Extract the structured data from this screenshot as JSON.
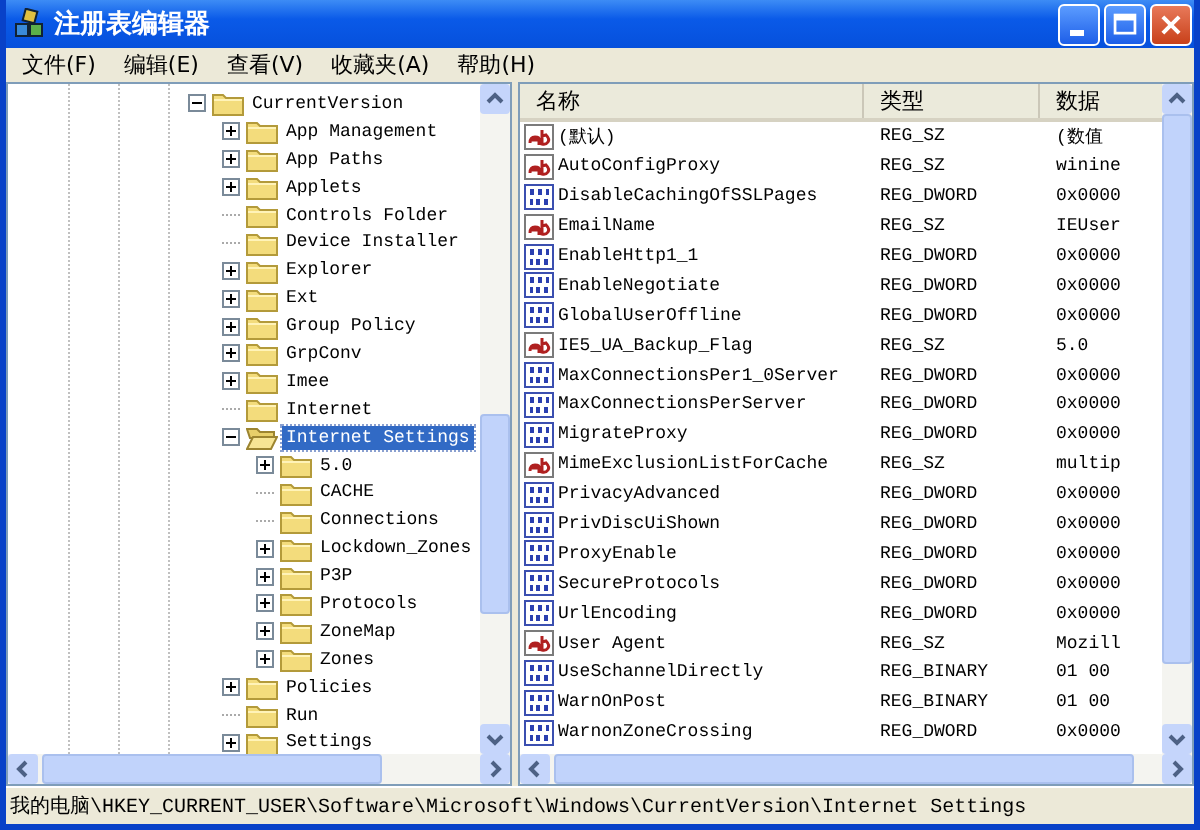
{
  "window": {
    "title": "注册表编辑器"
  },
  "menu": [
    {
      "label": "文件(F)"
    },
    {
      "label": "编辑(E)"
    },
    {
      "label": "查看(V)"
    },
    {
      "label": "收藏夹(A)"
    },
    {
      "label": "帮助(H)"
    }
  ],
  "tree": [
    {
      "label": "CurrentVersion",
      "kind": "branch",
      "expanded": true,
      "selected": false,
      "children": [
        {
          "label": "App Management",
          "kind": "branch",
          "expanded": false,
          "selected": false
        },
        {
          "label": "App Paths",
          "kind": "branch",
          "expanded": false,
          "selected": false
        },
        {
          "label": "Applets",
          "kind": "branch",
          "expanded": false,
          "selected": false
        },
        {
          "label": "Controls Folder",
          "kind": "leaf",
          "selected": false
        },
        {
          "label": "Device Installer",
          "kind": "leaf",
          "selected": false
        },
        {
          "label": "Explorer",
          "kind": "branch",
          "expanded": false,
          "selected": false
        },
        {
          "label": "Ext",
          "kind": "branch",
          "expanded": false,
          "selected": false
        },
        {
          "label": "Group Policy",
          "kind": "branch",
          "expanded": false,
          "selected": false
        },
        {
          "label": "GrpConv",
          "kind": "branch",
          "expanded": false,
          "selected": false
        },
        {
          "label": "Imee",
          "kind": "branch",
          "expanded": false,
          "selected": false
        },
        {
          "label": "Internet",
          "kind": "leaf",
          "selected": false
        },
        {
          "label": "Internet Settings",
          "kind": "branch",
          "expanded": true,
          "selected": true,
          "children": [
            {
              "label": "5.0",
              "kind": "branch",
              "expanded": false,
              "selected": false
            },
            {
              "label": "CACHE",
              "kind": "leaf",
              "selected": false
            },
            {
              "label": "Connections",
              "kind": "leaf",
              "selected": false
            },
            {
              "label": "Lockdown_Zones",
              "kind": "branch",
              "expanded": false,
              "selected": false
            },
            {
              "label": "P3P",
              "kind": "branch",
              "expanded": false,
              "selected": false
            },
            {
              "label": "Protocols",
              "kind": "branch",
              "expanded": false,
              "selected": false
            },
            {
              "label": "ZoneMap",
              "kind": "branch",
              "expanded": false,
              "selected": false
            },
            {
              "label": "Zones",
              "kind": "branch",
              "expanded": false,
              "selected": false
            }
          ]
        },
        {
          "label": "Policies",
          "kind": "branch",
          "expanded": false,
          "selected": false
        },
        {
          "label": "Run",
          "kind": "leaf",
          "selected": false
        },
        {
          "label": "Settings",
          "kind": "branch",
          "expanded": false,
          "selected": false
        }
      ]
    }
  ],
  "table": {
    "columns": [
      "名称",
      "类型",
      "数据"
    ],
    "rows": [
      {
        "kind": "string",
        "name": "(默认)",
        "type": "REG_SZ",
        "data": "(数值"
      },
      {
        "kind": "string",
        "name": "AutoConfigProxy",
        "type": "REG_SZ",
        "data": "winine"
      },
      {
        "kind": "binary",
        "name": "DisableCachingOfSSLPages",
        "type": "REG_DWORD",
        "data": "0x0000"
      },
      {
        "kind": "string",
        "name": "EmailName",
        "type": "REG_SZ",
        "data": "IEUser"
      },
      {
        "kind": "binary",
        "name": "EnableHttp1_1",
        "type": "REG_DWORD",
        "data": "0x0000"
      },
      {
        "kind": "binary",
        "name": "EnableNegotiate",
        "type": "REG_DWORD",
        "data": "0x0000"
      },
      {
        "kind": "binary",
        "name": "GlobalUserOffline",
        "type": "REG_DWORD",
        "data": "0x0000"
      },
      {
        "kind": "string",
        "name": "IE5_UA_Backup_Flag",
        "type": "REG_SZ",
        "data": "5.0"
      },
      {
        "kind": "binary",
        "name": "MaxConnectionsPer1_0Server",
        "type": "REG_DWORD",
        "data": "0x0000"
      },
      {
        "kind": "binary",
        "name": "MaxConnectionsPerServer",
        "type": "REG_DWORD",
        "data": "0x0000"
      },
      {
        "kind": "binary",
        "name": "MigrateProxy",
        "type": "REG_DWORD",
        "data": "0x0000"
      },
      {
        "kind": "string",
        "name": "MimeExclusionListForCache",
        "type": "REG_SZ",
        "data": "multip"
      },
      {
        "kind": "binary",
        "name": "PrivacyAdvanced",
        "type": "REG_DWORD",
        "data": "0x0000"
      },
      {
        "kind": "binary",
        "name": "PrivDiscUiShown",
        "type": "REG_DWORD",
        "data": "0x0000"
      },
      {
        "kind": "binary",
        "name": "ProxyEnable",
        "type": "REG_DWORD",
        "data": "0x0000"
      },
      {
        "kind": "binary",
        "name": "SecureProtocols",
        "type": "REG_DWORD",
        "data": "0x0000"
      },
      {
        "kind": "binary",
        "name": "UrlEncoding",
        "type": "REG_DWORD",
        "data": "0x0000"
      },
      {
        "kind": "string",
        "name": "User Agent",
        "type": "REG_SZ",
        "data": "Mozill"
      },
      {
        "kind": "binary",
        "name": "UseSchannelDirectly",
        "type": "REG_BINARY",
        "data": "01 00"
      },
      {
        "kind": "binary",
        "name": "WarnOnPost",
        "type": "REG_BINARY",
        "data": "01 00"
      },
      {
        "kind": "binary",
        "name": "WarnonZoneCrossing",
        "type": "REG_DWORD",
        "data": "0x0000"
      }
    ]
  },
  "status_bar": "我的电脑\\HKEY_CURRENT_USER\\Software\\Microsoft\\Windows\\CurrentVersion\\Internet Settings"
}
